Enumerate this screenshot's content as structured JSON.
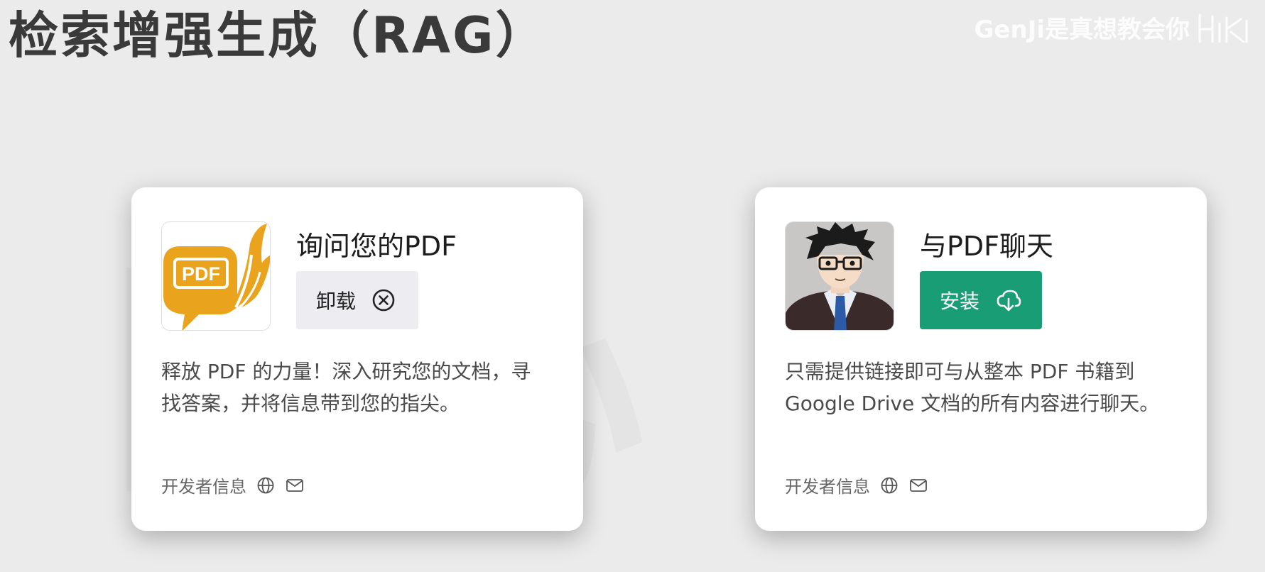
{
  "slide": {
    "title": "检索增强生成（RAG）",
    "watermark": "GenJi是真想教会你"
  },
  "plugins": [
    {
      "name": "询问您的PDF",
      "action_label": "卸载",
      "action_icon": "circle-x-icon",
      "description": "释放 PDF 的力量！深入研究您的文档，寻找答案，并将信息带到您的指尖。",
      "footer_label": "开发者信息",
      "footer_icons": [
        "globe-icon",
        "mail-icon"
      ],
      "icon": "pdf-logo",
      "icon_text": "PDF",
      "icon_color": "#eaa31c"
    },
    {
      "name": "与PDF聊天",
      "action_label": "安装",
      "action_icon": "cloud-download-icon",
      "description": "只需提供链接即可与从整本 PDF 书籍到 Google Drive 文档的所有内容进行聊天。",
      "footer_label": "开发者信息",
      "footer_icons": [
        "globe-icon",
        "mail-icon"
      ],
      "icon": "anime-avatar",
      "install_color": "#199d74"
    }
  ]
}
